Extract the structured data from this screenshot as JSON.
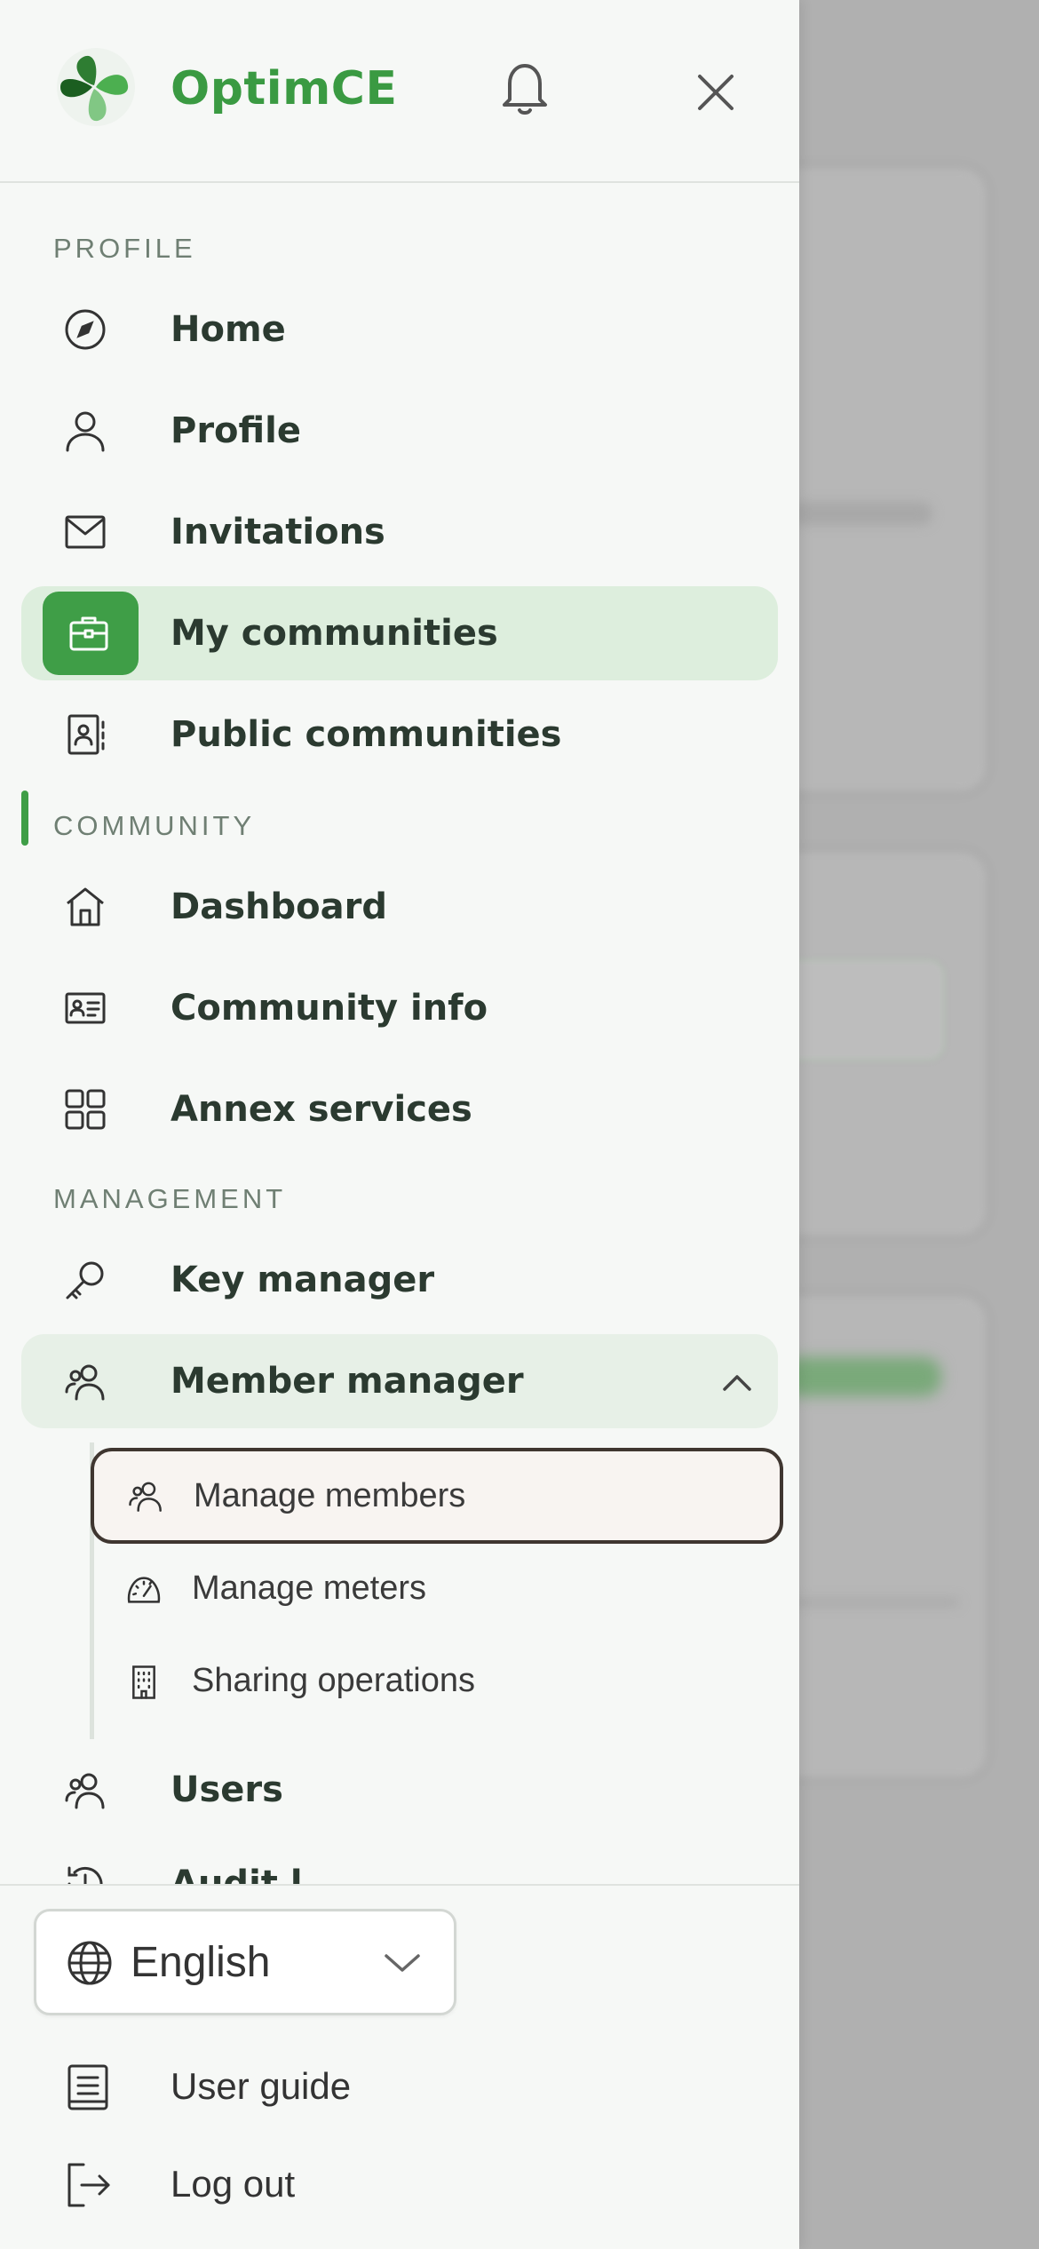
{
  "app": {
    "name": "OptimCE"
  },
  "sections": {
    "profile": "PROFILE",
    "community": "COMMUNITY",
    "management": "MANAGEMENT"
  },
  "nav": {
    "home": "Home",
    "profile": "Profile",
    "invitations": "Invitations",
    "my_communities": "My communities",
    "public_communities": "Public communities",
    "dashboard": "Dashboard",
    "community_info": "Community info",
    "annex_services": "Annex services",
    "key_manager": "Key manager",
    "member_manager": "Member manager",
    "manage_members": "Manage members",
    "manage_meters": "Manage meters",
    "sharing_operations": "Sharing operations",
    "users": "Users",
    "audit_log_partial": "Audit l..."
  },
  "footer": {
    "language": "English",
    "user_guide": "User guide",
    "log_out": "Log out"
  },
  "icons": {
    "logo": "clover-logo-icon",
    "bell": "bell-icon",
    "close": "close-icon",
    "home": "compass-icon",
    "profile": "user-icon",
    "invitations": "mail-icon",
    "my_communities": "briefcase-icon",
    "public_communities": "contact-book-icon",
    "dashboard": "house-icon",
    "community_info": "id-card-icon",
    "annex_services": "grid-icon",
    "key_manager": "key-icon",
    "member_manager": "users-icon",
    "manage_members": "users-icon",
    "manage_meters": "gauge-icon",
    "sharing_operations": "building-icon",
    "users": "users-icon",
    "audit": "history-icon",
    "language": "globe-icon",
    "user_guide": "book-icon",
    "log_out": "logout-icon"
  },
  "colors": {
    "accent": "#3f9e47",
    "brand_text": "#3a9a42",
    "active_bg": "#ddeedd",
    "open_bg": "#e7f0e7",
    "focus_border": "#3f3630"
  }
}
